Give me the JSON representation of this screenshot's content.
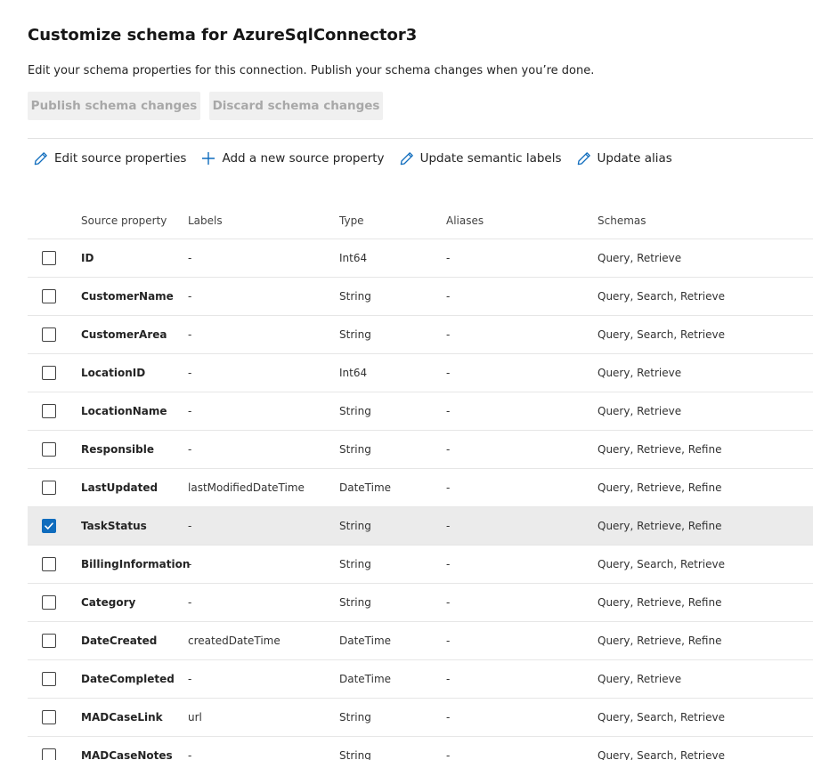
{
  "page": {
    "title": "Customize schema for AzureSqlConnector3",
    "subtitle": "Edit your schema properties for this connection. Publish your schema changes when you’re done."
  },
  "actions": {
    "publish_label": "Publish schema changes",
    "discard_label": "Discard schema changes"
  },
  "toolbar": {
    "items": [
      {
        "label": "Edit source properties",
        "icon": "pencil-icon"
      },
      {
        "label": "Add a new source property",
        "icon": "plus-icon"
      },
      {
        "label": "Update semantic labels",
        "icon": "pencil-icon"
      },
      {
        "label": "Update alias",
        "icon": "pencil-icon"
      }
    ]
  },
  "table": {
    "columns": [
      "Source property",
      "Labels",
      "Type",
      "Aliases",
      "Schemas"
    ],
    "rows": [
      {
        "name": "ID",
        "labels": "-",
        "type": "Int64",
        "aliases": "-",
        "schemas": "Query, Retrieve",
        "checked": false
      },
      {
        "name": "CustomerName",
        "labels": "-",
        "type": "String",
        "aliases": "-",
        "schemas": "Query, Search, Retrieve",
        "checked": false
      },
      {
        "name": "CustomerArea",
        "labels": "-",
        "type": "String",
        "aliases": "-",
        "schemas": "Query, Search, Retrieve",
        "checked": false
      },
      {
        "name": "LocationID",
        "labels": "-",
        "type": "Int64",
        "aliases": "-",
        "schemas": "Query, Retrieve",
        "checked": false
      },
      {
        "name": "LocationName",
        "labels": "-",
        "type": "String",
        "aliases": "-",
        "schemas": "Query, Retrieve",
        "checked": false
      },
      {
        "name": "Responsible",
        "labels": "-",
        "type": "String",
        "aliases": "-",
        "schemas": "Query, Retrieve, Refine",
        "checked": false
      },
      {
        "name": "LastUpdated",
        "labels": "lastModifiedDateTime",
        "type": "DateTime",
        "aliases": "-",
        "schemas": "Query, Retrieve, Refine",
        "checked": false
      },
      {
        "name": "TaskStatus",
        "labels": "-",
        "type": "String",
        "aliases": "-",
        "schemas": "Query, Retrieve, Refine",
        "checked": true
      },
      {
        "name": "BillingInformation",
        "labels": "-",
        "type": "String",
        "aliases": "-",
        "schemas": "Query, Search, Retrieve",
        "checked": false
      },
      {
        "name": "Category",
        "labels": "-",
        "type": "String",
        "aliases": "-",
        "schemas": "Query, Retrieve, Refine",
        "checked": false
      },
      {
        "name": "DateCreated",
        "labels": "createdDateTime",
        "type": "DateTime",
        "aliases": "-",
        "schemas": "Query, Retrieve, Refine",
        "checked": false
      },
      {
        "name": "DateCompleted",
        "labels": "-",
        "type": "DateTime",
        "aliases": "-",
        "schemas": "Query, Retrieve",
        "checked": false
      },
      {
        "name": "MADCaseLink",
        "labels": "url",
        "type": "String",
        "aliases": "-",
        "schemas": "Query, Search, Retrieve",
        "checked": false
      },
      {
        "name": "MADCaseNotes",
        "labels": "-",
        "type": "String",
        "aliases": "-",
        "schemas": "Query, Search, Retrieve",
        "checked": false
      }
    ]
  },
  "colors": {
    "accent": "#0f6cbd",
    "selected_row": "#ebebeb",
    "disabled_button_bg": "#f0f0f0",
    "disabled_button_text": "#a8a8a8"
  }
}
